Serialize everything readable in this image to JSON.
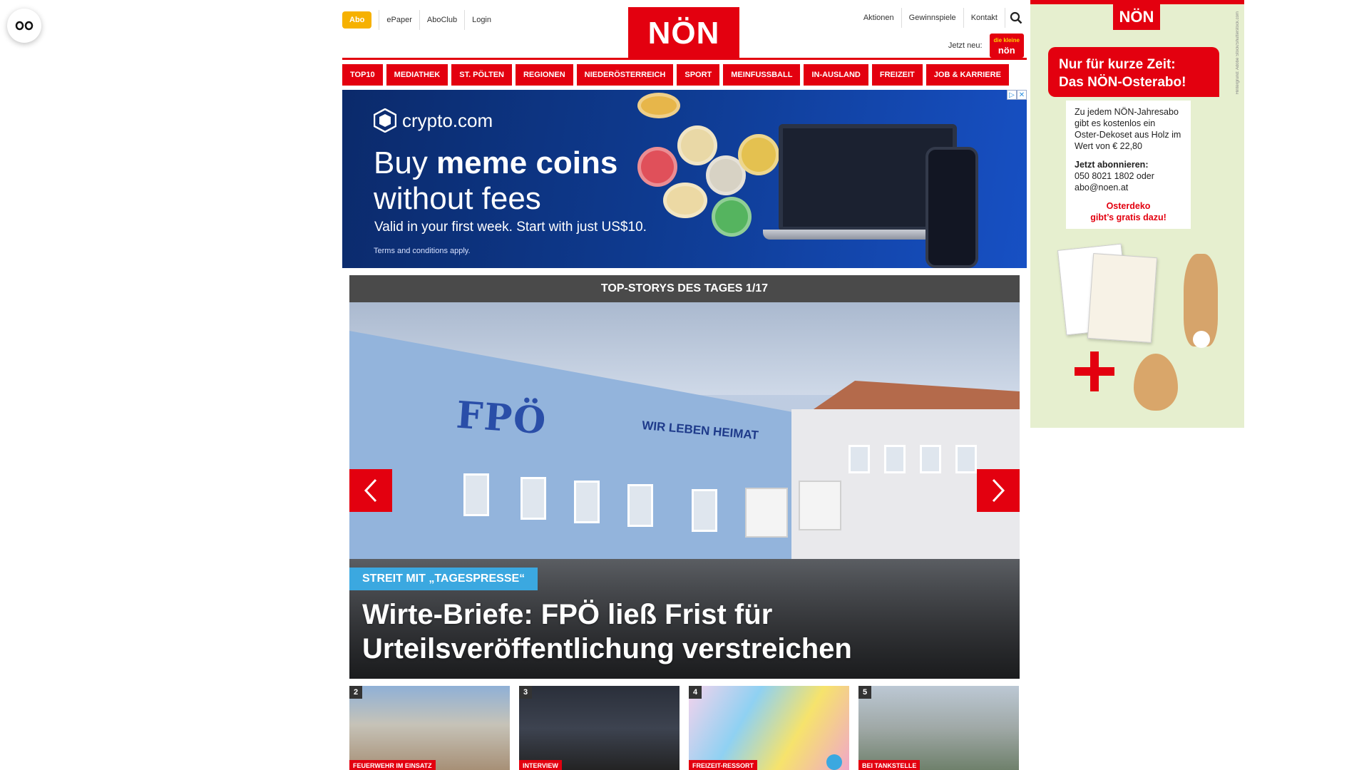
{
  "reader_button": {
    "icon": "reader-mode-icon"
  },
  "header": {
    "abo_label": "Abo",
    "util_left": [
      "ePaper",
      "AboClub",
      "Login"
    ],
    "logo_text": "NÖN",
    "util_right": [
      "Aktionen",
      "Gewinnspiele",
      "Kontakt"
    ],
    "search_icon": "search-icon",
    "jetzt_neu_label": "Jetzt neu:",
    "kids_badge_top": "die kleine",
    "kids_badge_main": "nön"
  },
  "nav": {
    "items": [
      "TOP10",
      "MEDIATHEK",
      "ST. PÖLTEN",
      "REGIONEN",
      "NIEDERÖSTERREICH",
      "SPORT",
      "MEINFUSSBALL",
      "IN-AUSLAND",
      "FREIZEIT",
      "JOB & KARRIERE"
    ],
    "color": "#e3000f"
  },
  "ad": {
    "brand": "crypto.com",
    "headline_plain": "Buy ",
    "headline_bold": "meme coins",
    "headline_line2": "without fees",
    "sub": "Valid in your first week. Start with just US$10.",
    "terms": "Terms and conditions apply.",
    "choices_icons": [
      "adchoices-icon",
      "close-icon"
    ]
  },
  "stories": {
    "header": "TOP-STORYS DES TAGES 1/17",
    "hero": {
      "kicker": "STREIT MIT „TAGESPRESSE“",
      "title": "Wirte-Briefe: FPÖ ließ Frist für Urteilsveröffentlichung verstreichen",
      "sign_main": "FPÖ",
      "sign_secondary": "WIR LEBEN HEIMAT"
    },
    "thumbs": [
      {
        "num": "2",
        "tag": "FEUERWEHR IM EINSATZ"
      },
      {
        "num": "3",
        "tag": "INTERVIEW"
      },
      {
        "num": "4",
        "tag": "FREIZEIT-RESSORT"
      },
      {
        "num": "5",
        "tag": "BEI TANKSTELLE"
      }
    ]
  },
  "side_ad": {
    "logo": "NÖN",
    "headline_line1": "Nur für kurze Zeit:",
    "headline_line2": "Das NÖN-Osterabo!",
    "body": "Zu jedem NÖN-Jahresabo gibt es kostenlos ein Oster-Dekoset aus Holz im Wert von € 22,80",
    "subscribe_label": "Jetzt abonnieren:",
    "subscribe_contact": "050 8021 1802 oder abo@noen.at",
    "promo_line1": "Osterdeko",
    "promo_line2": "gibt’s gratis dazu!",
    "legal": "Hintergrund: Adobe Stock/Shutterstock.com"
  }
}
